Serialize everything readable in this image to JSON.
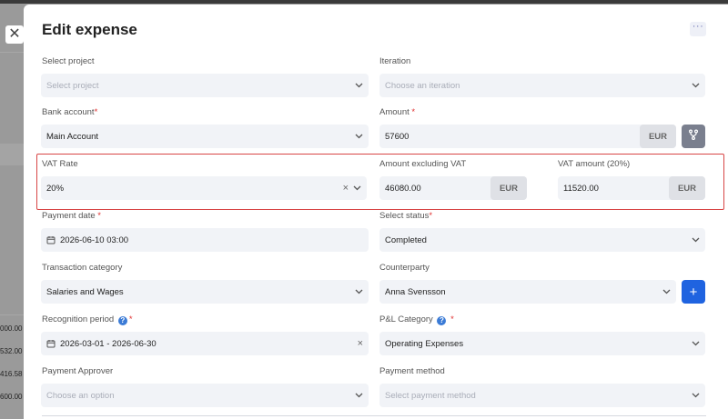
{
  "background": {
    "numbers": [
      "000.00",
      "532.00",
      "416.58",
      "600.00"
    ]
  },
  "modal": {
    "title": "Edit expense"
  },
  "fields": {
    "project": {
      "label": "Select project",
      "placeholder": "Select project"
    },
    "iteration": {
      "label": "Iteration",
      "placeholder": "Choose an iteration"
    },
    "bank_account": {
      "label": "Bank account",
      "value": "Main Account"
    },
    "amount": {
      "label": "Amount",
      "value": "57600",
      "unit": "EUR"
    },
    "vat_rate": {
      "label": "VAT Rate",
      "value": "20%"
    },
    "amount_excl_vat": {
      "label": "Amount excluding VAT",
      "value": "46080.00",
      "unit": "EUR"
    },
    "vat_amount": {
      "label": "VAT amount (20%)",
      "value": "11520.00",
      "unit": "EUR"
    },
    "payment_date": {
      "label": "Payment date",
      "value": "2026-06-10 03:00"
    },
    "status": {
      "label": "Select status",
      "value": "Completed"
    },
    "transaction_category": {
      "label": "Transaction category",
      "value": "Salaries and Wages"
    },
    "counterparty": {
      "label": "Counterparty",
      "value": "Anna Svensson"
    },
    "recognition_period": {
      "label": "Recognition period",
      "value": "2026-03-01 - 2026-06-30"
    },
    "pl_category": {
      "label": "P&L Category",
      "value": "Operating Expenses"
    },
    "payment_approver": {
      "label": "Payment Approver",
      "placeholder": "Choose an option"
    },
    "payment_method": {
      "label": "Payment method",
      "placeholder": "Select payment method"
    }
  },
  "symbols": {
    "required": "*",
    "help": "?",
    "close": "✕",
    "more": "···",
    "clear": "×",
    "plus": "+"
  },
  "icons": {
    "close": "close-icon",
    "more": "more-horizontal-icon",
    "chevron": "chevron-down-icon",
    "calendar": "calendar-icon",
    "branch": "branch-icon",
    "help": "help-circle-icon",
    "clear": "clear-icon",
    "plus": "plus-icon"
  },
  "colors": {
    "primary": "#1f63e0",
    "required": "#e03030",
    "highlight": "#d84545"
  }
}
